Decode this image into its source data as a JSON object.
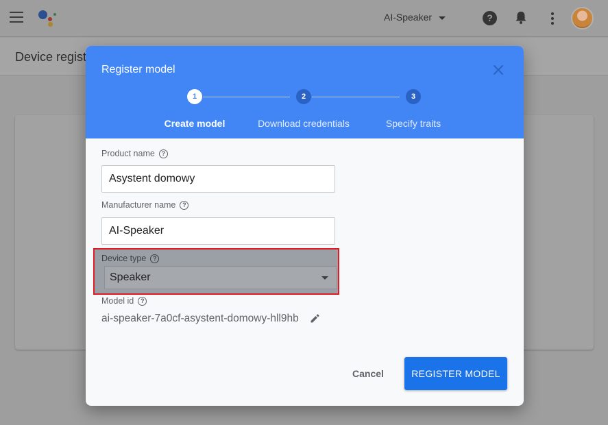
{
  "topbar": {
    "project_name": "AI-Speaker",
    "help_icon_glyph": "?",
    "icons": [
      "menu-icon",
      "google-assistant-logo",
      "chevron-down-icon",
      "help-icon",
      "bell-icon",
      "more-vert-icon",
      "avatar"
    ]
  },
  "page": {
    "title": "Device regist"
  },
  "dialog": {
    "title": "Register model",
    "close_icon": "close-icon",
    "steps": [
      {
        "number": "1",
        "label": "Create model",
        "state": "active"
      },
      {
        "number": "2",
        "label": "Download credentials",
        "state": "inactive"
      },
      {
        "number": "3",
        "label": "Specify traits",
        "state": "inactive"
      }
    ],
    "fields": {
      "product_name": {
        "label": "Product name",
        "value": "Asystent domowy"
      },
      "manufacturer_name": {
        "label": "Manufacturer name",
        "value": "AI-Speaker"
      },
      "device_type": {
        "label": "Device type",
        "value": "Speaker"
      },
      "model_id": {
        "label": "Model id",
        "value": "ai-speaker-7a0cf-asystent-domowy-hll9hb"
      }
    },
    "help_glyph": "?",
    "buttons": {
      "cancel": "Cancel",
      "register": "REGISTER MODEL"
    }
  },
  "colors": {
    "header_blue": "#4285f4",
    "primary_button": "#1a73e8",
    "highlight_border": "#e01b24"
  }
}
